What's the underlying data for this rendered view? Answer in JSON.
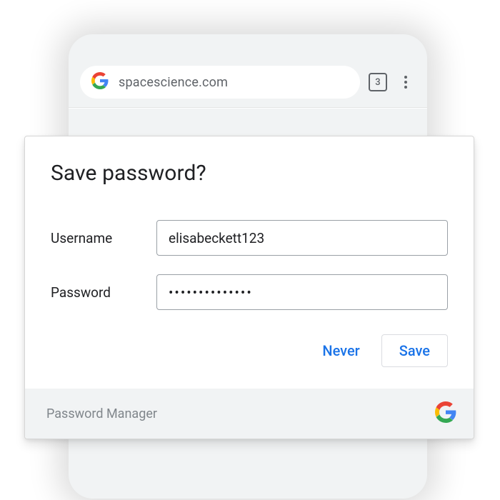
{
  "browser": {
    "url": "spacescience.com",
    "tab_count": "3"
  },
  "dialog": {
    "title": "Save password?",
    "username_label": "Username",
    "username_value": "elisabeckett123",
    "password_label": "Password",
    "password_value": "••••••••••••••",
    "never_label": "Never",
    "save_label": "Save",
    "footer_label": "Password Manager"
  }
}
